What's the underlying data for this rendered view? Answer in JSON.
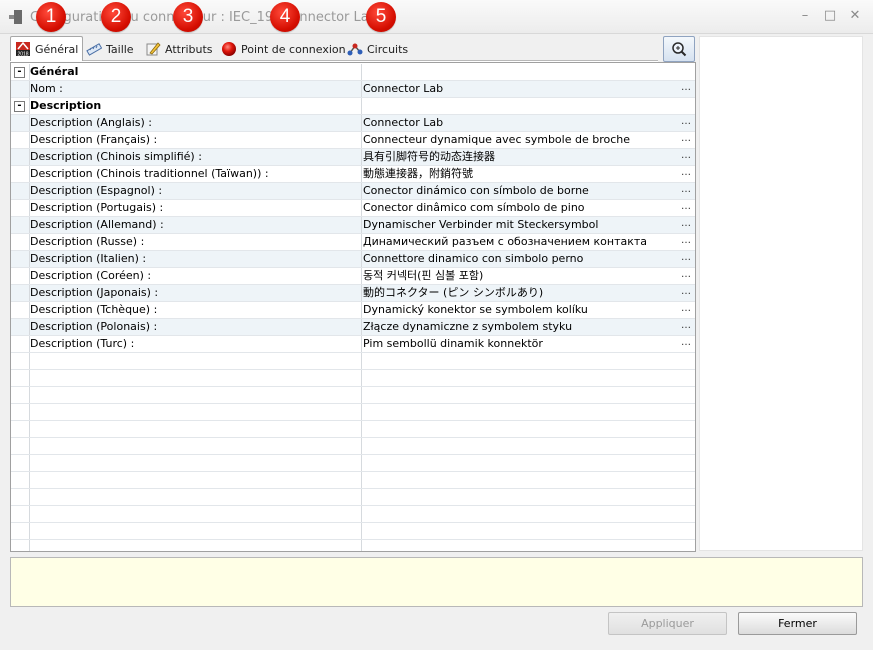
{
  "window": {
    "title": "Configuration du connecteur : IEC_19 (Connector Lab)",
    "controls": [
      "minimize-icon",
      "maximize-icon",
      "close-icon"
    ]
  },
  "badges": [
    "1",
    "2",
    "3",
    "4",
    "5"
  ],
  "tabs": [
    {
      "label": "Général",
      "icon": "general-icon",
      "active": true
    },
    {
      "label": "Taille",
      "icon": "ruler-icon",
      "active": false
    },
    {
      "label": "Attributs",
      "icon": "pencil-icon",
      "active": false
    },
    {
      "label": "Point de connexion",
      "icon": "red-ball-icon",
      "active": false
    },
    {
      "label": "Circuits",
      "icon": "circuit-icon",
      "active": false
    }
  ],
  "grid": {
    "sections": [
      {
        "title": "Général",
        "toggle": "-",
        "rows": [
          {
            "key": "Nom :",
            "value": "Connector Lab"
          }
        ]
      },
      {
        "title": "Description",
        "toggle": "-",
        "rows": [
          {
            "key": "Description (Anglais) :",
            "value": "Connector Lab"
          },
          {
            "key": "Description (Français) :",
            "value": "Connecteur dynamique avec symbole de broche"
          },
          {
            "key": "Description (Chinois simplifié) :",
            "value": "具有引脚符号的动态连接器"
          },
          {
            "key": "Description (Chinois traditionnel (Taïwan)) :",
            "value": "動態連接器，附銷符號"
          },
          {
            "key": "Description (Espagnol) :",
            "value": "Conector dinámico con símbolo de borne"
          },
          {
            "key": "Description (Portugais) :",
            "value": "Conector dinâmico com símbolo de pino"
          },
          {
            "key": "Description (Allemand) :",
            "value": "Dynamischer Verbinder mit Steckersymbol"
          },
          {
            "key": "Description (Russe) :",
            "value": "Динамический разъем с обозначением контакта"
          },
          {
            "key": "Description (Italien) :",
            "value": "Connettore dinamico con simbolo perno"
          },
          {
            "key": "Description (Coréen) :",
            "value": "동적 커넥터(핀 심볼 포함)"
          },
          {
            "key": "Description (Japonais) :",
            "value": "動的コネクター (ピン シンボルあり)"
          },
          {
            "key": "Description (Tchèque) :",
            "value": "Dynamický konektor se symbolem kolíku"
          },
          {
            "key": "Description (Polonais) :",
            "value": "Złącze dynamiczne z symbolem styku"
          },
          {
            "key": "Description (Turc) :",
            "value": "Pim sembollü dinamik konnektör"
          }
        ]
      }
    ],
    "ellipsis": "…"
  },
  "buttons": {
    "apply": "Appliquer",
    "close": "Fermer"
  },
  "colors": {
    "badge": "#d40d00",
    "row_alt": "#eef4f8",
    "info_bg": "#ffffe6"
  }
}
